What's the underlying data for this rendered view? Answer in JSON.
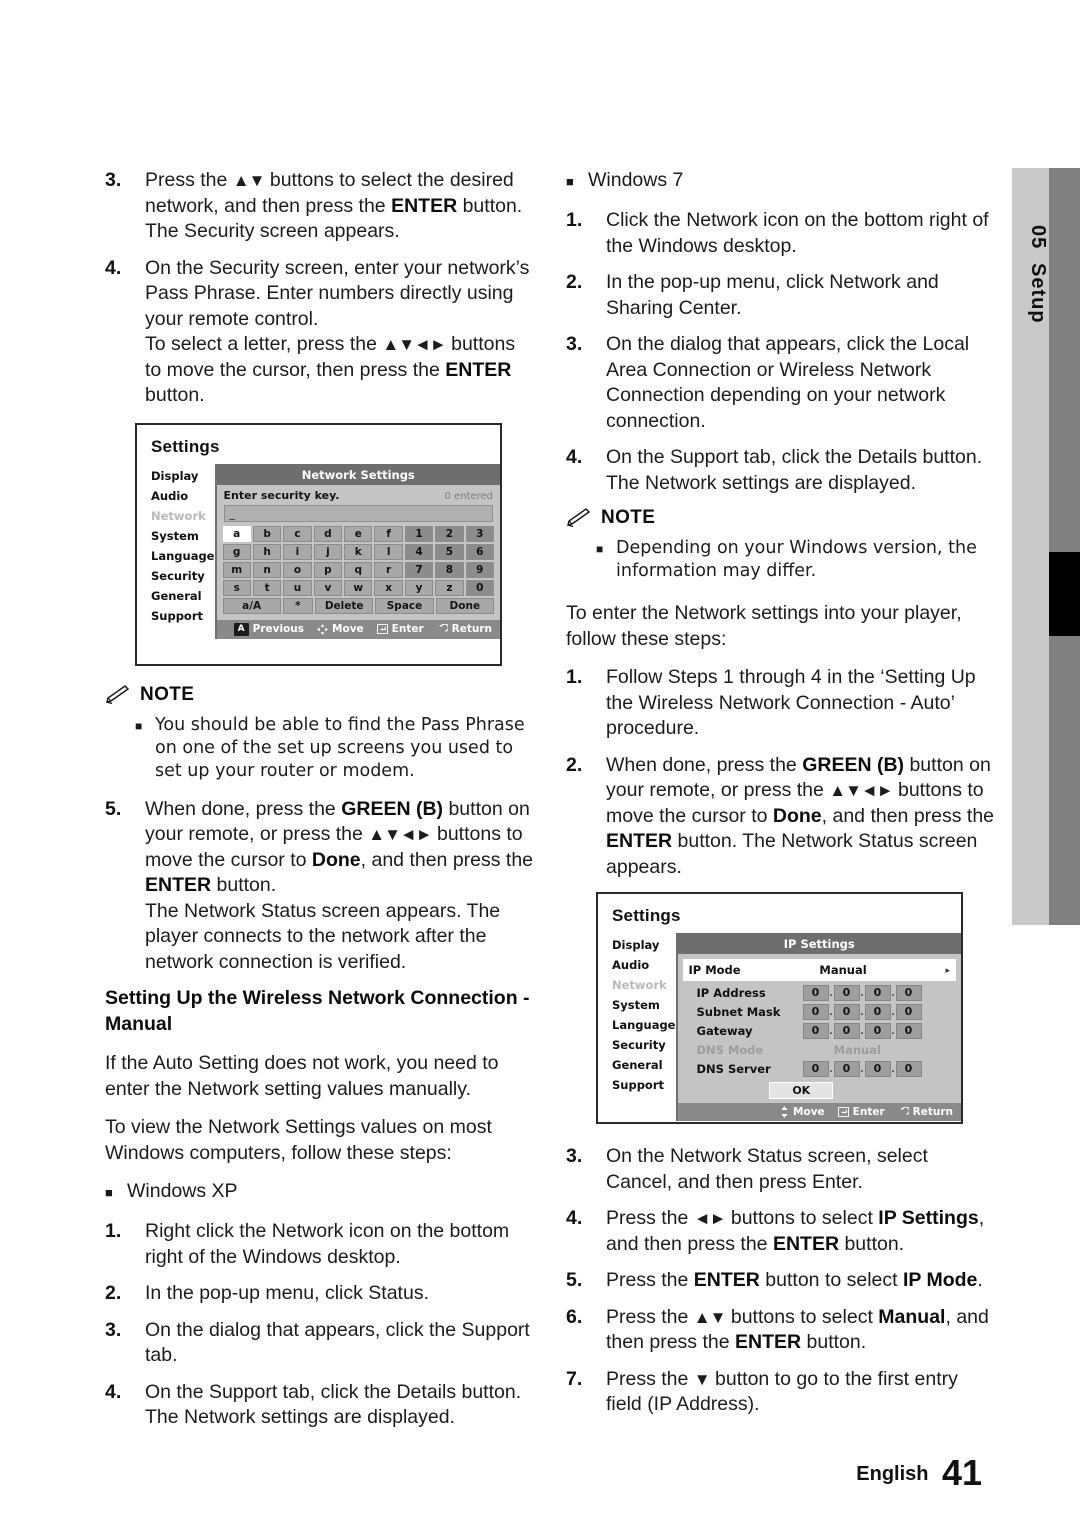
{
  "page": {
    "chapter_number": "05",
    "chapter_name": "Setup",
    "footer_language": "English",
    "footer_page": "41"
  },
  "left_column": {
    "step3": {
      "num": "3.",
      "text_a": "Press the ",
      "arrows_a": "▲▼",
      "text_b": " buttons to select the desired network, and then press the ",
      "bold_b": "ENTER",
      "text_c": " button. The Security screen appears."
    },
    "step4": {
      "num": "4.",
      "text_a": "On the Security screen, enter your network’s Pass Phrase. Enter numbers directly using your remote control.",
      "text_b": "To select a letter, press the ",
      "arrows_b": "▲▼◄►",
      "text_c": " buttons to move the cursor, then press the ",
      "bold_c": "ENTER",
      "text_d": " button."
    },
    "osd_security": {
      "title": "Settings",
      "menu": [
        "Display",
        "Audio",
        "Network",
        "System",
        "Language",
        "Security",
        "General",
        "Support"
      ],
      "dim_menu_item": "Network",
      "panel_title": "Network Settings",
      "prompt": "Enter security key.",
      "counter": "0 entered",
      "input_value": "_",
      "keyboard_rows": [
        [
          "a",
          "b",
          "c",
          "d",
          "e",
          "f",
          "1",
          "2",
          "3"
        ],
        [
          "g",
          "h",
          "i",
          "j",
          "k",
          "l",
          "4",
          "5",
          "6"
        ],
        [
          "m",
          "n",
          "o",
          "p",
          "q",
          "r",
          "7",
          "8",
          "9"
        ],
        [
          "s",
          "t",
          "u",
          "v",
          "w",
          "x",
          "y",
          "z",
          "0"
        ]
      ],
      "selected_key": "a",
      "action_keys": [
        "a/A",
        "*",
        "Delete",
        "Space",
        "Done"
      ],
      "footer": {
        "key_a": "A",
        "previous": "Previous",
        "move": "Move",
        "enter": "Enter",
        "return": "Return"
      }
    },
    "note1": {
      "label": "NOTE",
      "items": [
        "You should be able to find the Pass Phrase on one of the set up screens you used to set up your router or modem."
      ]
    },
    "step5": {
      "num": "5.",
      "text_a": "When done, press the ",
      "bold_a": "GREEN (B)",
      "text_b": " button on your remote, or press the ",
      "arrows_b": "▲▼◄►",
      "text_c": " buttons to move the cursor to ",
      "bold_c": "Done",
      "text_d": ", and then press the ",
      "bold_d": "ENTER",
      "text_e": " button.",
      "text_f": "The Network Status screen appears. The player connects to the network after the network connection is verified."
    },
    "heading": "Setting Up the Wireless Network Connection - Manual",
    "intro1": "If the Auto Setting does not work, you need to enter the Network setting values manually.",
    "intro2": "To view the Network Settings values on most Windows computers, follow these steps:",
    "os_bullet": "Windows XP",
    "xp_steps": [
      {
        "num": "1.",
        "text": "Right click the Network icon on the bottom right of the Windows desktop."
      },
      {
        "num": "2.",
        "text": "In the pop-up menu, click Status."
      },
      {
        "num": "3.",
        "text": "On the dialog that appears, click the Support tab."
      },
      {
        "num": "4.",
        "text": "On the Support tab, click the Details button. The Network settings are displayed."
      }
    ]
  },
  "right_column": {
    "os_bullet": "Windows 7",
    "win7_steps": [
      {
        "num": "1.",
        "text": "Click the Network icon on the bottom right of the Windows desktop."
      },
      {
        "num": "2.",
        "text": "In the pop-up menu, click Network and Sharing Center."
      },
      {
        "num": "3.",
        "text": "On the dialog that appears, click the Local Area Connection or Wireless Network Connection depending on your network connection."
      },
      {
        "num": "4.",
        "text": "On the Support tab, click the Details button. The Network settings are displayed."
      }
    ],
    "note2": {
      "label": "NOTE",
      "items": [
        "Depending on your Windows version, the information may differ."
      ]
    },
    "intro": "To enter the Network settings into your player, follow these steps:",
    "step1": {
      "num": "1.",
      "text": "Follow Steps 1 through 4 in the ‘Setting Up the Wireless Network Connection - Auto’ procedure."
    },
    "step2": {
      "num": "2.",
      "text_a": "When done, press the ",
      "bold_a": "GREEN (B)",
      "text_b": " button on your remote, or press the ",
      "arrows_b": "▲▼◄►",
      "text_c": " buttons to move the cursor to ",
      "bold_c": "Done",
      "text_d": ", and then press the ",
      "bold_d": "ENTER",
      "text_e": " button. The Network Status screen appears."
    },
    "osd_ip": {
      "title": "Settings",
      "menu": [
        "Display",
        "Audio",
        "Network",
        "System",
        "Language",
        "Security",
        "General",
        "Support"
      ],
      "dim_menu_item": "Network",
      "panel_title": "IP Settings",
      "ip_mode_label": "IP Mode",
      "ip_mode_value": "Manual",
      "rows": [
        {
          "label": "IP Address",
          "octets": [
            "0",
            "0",
            "0",
            "0"
          ]
        },
        {
          "label": "Subnet Mask",
          "octets": [
            "0",
            "0",
            "0",
            "0"
          ]
        },
        {
          "label": "Gateway",
          "octets": [
            "0",
            "0",
            "0",
            "0"
          ]
        }
      ],
      "dns_mode_label": "DNS Mode",
      "dns_mode_value": "Manual",
      "dns_server": {
        "label": "DNS Server",
        "octets": [
          "0",
          "0",
          "0",
          "0"
        ]
      },
      "ok_label": "OK",
      "footer": {
        "move": "Move",
        "enter": "Enter",
        "return": "Return"
      }
    },
    "step3": {
      "num": "3.",
      "text": "On the Network Status screen, select Cancel, and then press Enter."
    },
    "step4": {
      "num": "4.",
      "text_a": "Press the ",
      "arrows_a": "◄►",
      "text_b": " buttons to select ",
      "bold_b": "IP Settings",
      "text_c": ", and then press the ",
      "bold_c": "ENTER",
      "text_d": " button."
    },
    "step5": {
      "num": "5.",
      "text_a": "Press the ",
      "bold_a": "ENTER",
      "text_b": " button to select ",
      "bold_b": "IP Mode",
      "text_c": "."
    },
    "step6": {
      "num": "6.",
      "text_a": "Press the ",
      "arrows_a": "▲▼",
      "text_b": " buttons to select ",
      "bold_b": "Manual",
      "text_c": ", and then press the ",
      "bold_c": "ENTER",
      "text_d": " button."
    },
    "step7": {
      "num": "7.",
      "text_a": "Press the ",
      "arrows_a": "▼",
      "text_b": " button to go to the first entry field (IP Address)."
    }
  }
}
